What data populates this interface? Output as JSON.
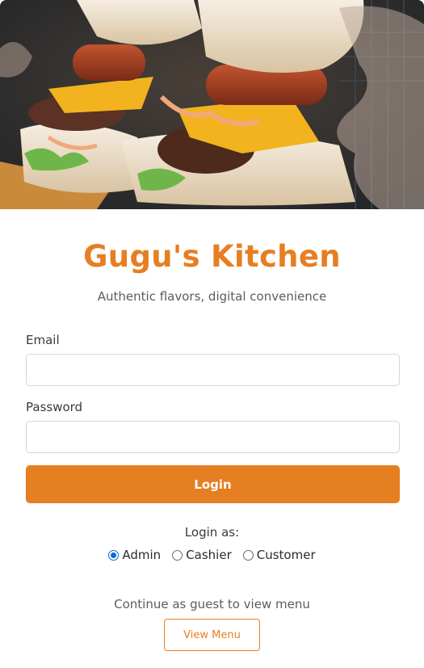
{
  "hero": {
    "image_description_icon": "burger-photo"
  },
  "brand": {
    "title": "Gugu's Kitchen",
    "subtitle": "Authentic flavors, digital convenience",
    "accent_color": "#e67e22"
  },
  "form": {
    "email_label": "Email",
    "email_value": "",
    "email_placeholder": "",
    "password_label": "Password",
    "password_value": "",
    "password_placeholder": "",
    "login_label": "Login"
  },
  "role": {
    "prompt": "Login as:",
    "options": [
      {
        "label": "Admin",
        "selected": true
      },
      {
        "label": "Cashier",
        "selected": false
      },
      {
        "label": "Customer",
        "selected": false
      }
    ]
  },
  "guest": {
    "text": "Continue as guest to view menu",
    "button_label": "View Menu"
  }
}
